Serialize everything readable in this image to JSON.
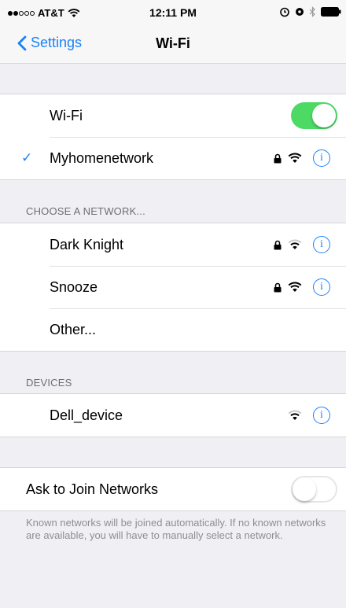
{
  "status_bar": {
    "carrier": "AT&T",
    "time": "12:11 PM",
    "signal_full_dots": 2,
    "signal_total_dots": 5
  },
  "nav": {
    "back_label": "Settings",
    "title": "Wi-Fi"
  },
  "wifi_toggle": {
    "label": "Wi-Fi",
    "on": true
  },
  "connected_network": {
    "name": "Myhomenetwork",
    "secured": true,
    "info_glyph": "i"
  },
  "choose_network": {
    "header": "CHOOSE A NETWORK...",
    "networks": [
      {
        "name": "Dark Knight",
        "secured": true,
        "info_glyph": "i"
      },
      {
        "name": "Snooze",
        "secured": true,
        "info_glyph": "i"
      }
    ],
    "other_label": "Other..."
  },
  "devices": {
    "header": "DEVICES",
    "items": [
      {
        "name": "Dell_device",
        "secured": false,
        "info_glyph": "i"
      }
    ]
  },
  "ask_to_join": {
    "label": "Ask to Join Networks",
    "on": false,
    "footer": "Known networks will be joined automatically. If no known networks are available, you will have to manually select a network."
  },
  "colors": {
    "accent": "#1a82fb",
    "toggle_on": "#4cd964",
    "background": "#efeff4"
  },
  "icons": [
    "wifi-icon",
    "lock-icon",
    "info-icon",
    "checkmark-icon",
    "chevron-left-icon",
    "battery-icon",
    "bluetooth-icon",
    "alarm-icon",
    "location-icon"
  ]
}
